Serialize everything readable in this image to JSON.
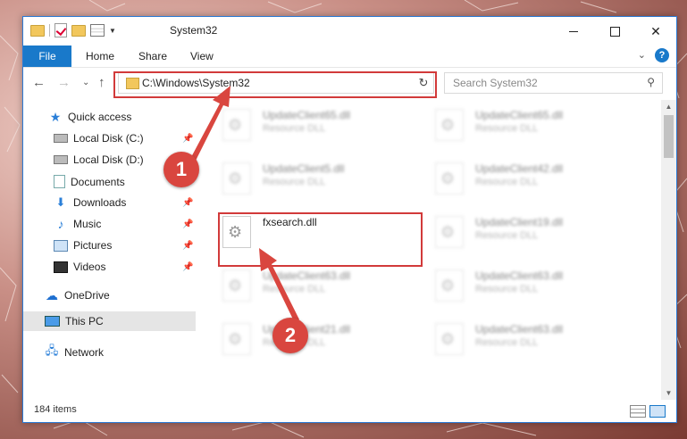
{
  "window": {
    "title": "System32"
  },
  "ribbon": {
    "file": "File",
    "home": "Home",
    "share": "Share",
    "view": "View",
    "help": "?"
  },
  "address": {
    "path": "C:\\Windows\\System32"
  },
  "search": {
    "placeholder": "Search System32"
  },
  "sidebar": {
    "items": [
      {
        "label": "Quick access",
        "icon": "star-icon"
      },
      {
        "label": "Local Disk (C:)",
        "icon": "drive-icon",
        "pinned": true
      },
      {
        "label": "Local Disk (D:)",
        "icon": "drive-icon"
      },
      {
        "label": "Documents",
        "icon": "document-icon"
      },
      {
        "label": "Downloads",
        "icon": "download-icon",
        "pinned": true
      },
      {
        "label": "Music",
        "icon": "music-icon",
        "pinned": true
      },
      {
        "label": "Pictures",
        "icon": "picture-icon",
        "pinned": true
      },
      {
        "label": "Videos",
        "icon": "video-icon",
        "pinned": true
      },
      {
        "label": "OneDrive",
        "icon": "cloud-icon"
      },
      {
        "label": "This PC",
        "icon": "computer-icon",
        "selected": true
      },
      {
        "label": "Network",
        "icon": "network-icon"
      }
    ]
  },
  "files": [
    {
      "name": "UpdateClient65.dll",
      "type": "Resource DLL"
    },
    {
      "name": "UpdateClient65.dll",
      "type": "Resource DLL"
    },
    {
      "name": "UpdateClient5.dll",
      "type": "Resource DLL"
    },
    {
      "name": "UpdateClient42.dll",
      "type": "Resource DLL"
    },
    {
      "name": "fxsearch.dll",
      "type": ""
    },
    {
      "name": "UpdateClient19.dll",
      "type": "Resource DLL"
    },
    {
      "name": "UpdateClient63.dll",
      "type": "Resource DLL"
    },
    {
      "name": "UpdateClient63.dll",
      "type": "Resource DLL"
    },
    {
      "name": "UpdateClient21.dll",
      "type": "Resource DLL"
    },
    {
      "name": "UpdateClient63.dll",
      "type": "Resource DLL"
    }
  ],
  "status": {
    "items": "184 items"
  },
  "markers": {
    "one": "1",
    "two": "2"
  },
  "colors": {
    "accent": "#1979ca",
    "highlight": "#d23a3a",
    "marker": "#d9463f"
  }
}
